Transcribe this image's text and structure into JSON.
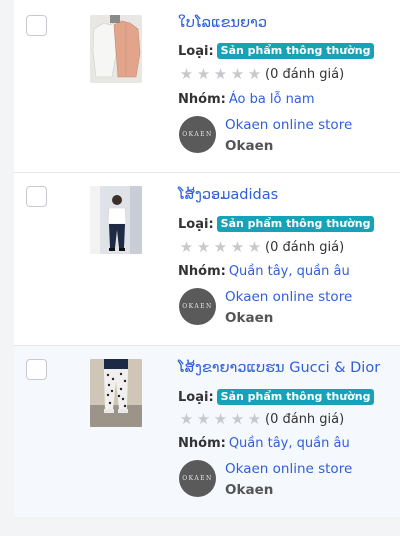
{
  "products": [
    {
      "name": "ໃບໂລແຂນຍາວ",
      "type_label": "Loại:",
      "type_badge": "Sản phẩm thông thường",
      "reviews": "(0 đánh giá)",
      "group_label": "Nhóm:",
      "group": "Áo ba lỗ nam",
      "store_link": "Okaen online store",
      "store_name": "Okaen",
      "logo_text": "OKAEN"
    },
    {
      "name": "ໂສ້ງວອມadidas",
      "type_label": "Loại:",
      "type_badge": "Sản phẩm thông thường",
      "reviews": "(0 đánh giá)",
      "group_label": "Nhóm:",
      "group": "Quần tây, quần âu",
      "store_link": "Okaen online store",
      "store_name": "Okaen",
      "logo_text": "OKAEN"
    },
    {
      "name": "ໂສ້ງຂາຍາວແບຮນ Gucci & Dior",
      "type_label": "Loại:",
      "type_badge": "Sản phẩm thông thường",
      "reviews": "(0 đánh giá)",
      "group_label": "Nhóm:",
      "group": "Quần tây, quần âu",
      "store_link": "Okaen online store",
      "store_name": "Okaen",
      "logo_text": "OKAEN"
    }
  ],
  "rating_stars": 5,
  "colors": {
    "link": "#2f5fd9",
    "badge": "#17a2b8",
    "star_empty": "#c7c9cc",
    "highlight_row": "#f5f8fd"
  }
}
